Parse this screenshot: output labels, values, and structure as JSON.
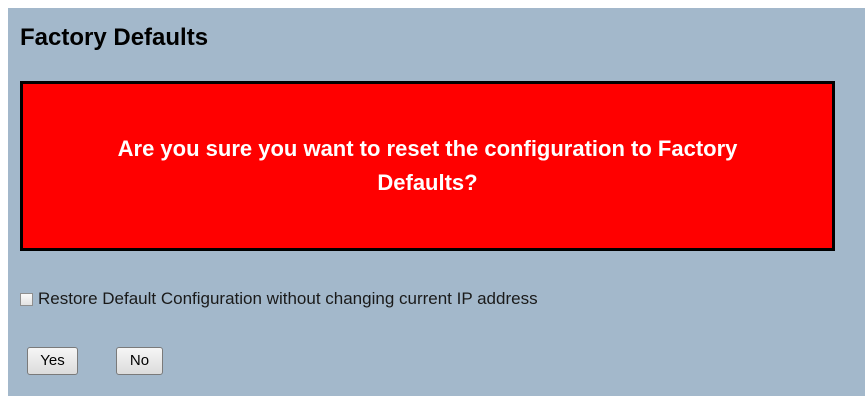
{
  "page": {
    "title": "Factory Defaults"
  },
  "warning": {
    "message": "Are you sure you want to reset the configuration to Factory Defaults?"
  },
  "option": {
    "checkbox_checked": false,
    "label": "Restore Default Configuration without changing current IP address"
  },
  "buttons": {
    "yes_label": "Yes",
    "no_label": "No"
  },
  "colors": {
    "page_background": "#a3b8cb",
    "warning_background": "#ff0000",
    "warning_text": "#ffffff",
    "warning_border": "#000000"
  }
}
